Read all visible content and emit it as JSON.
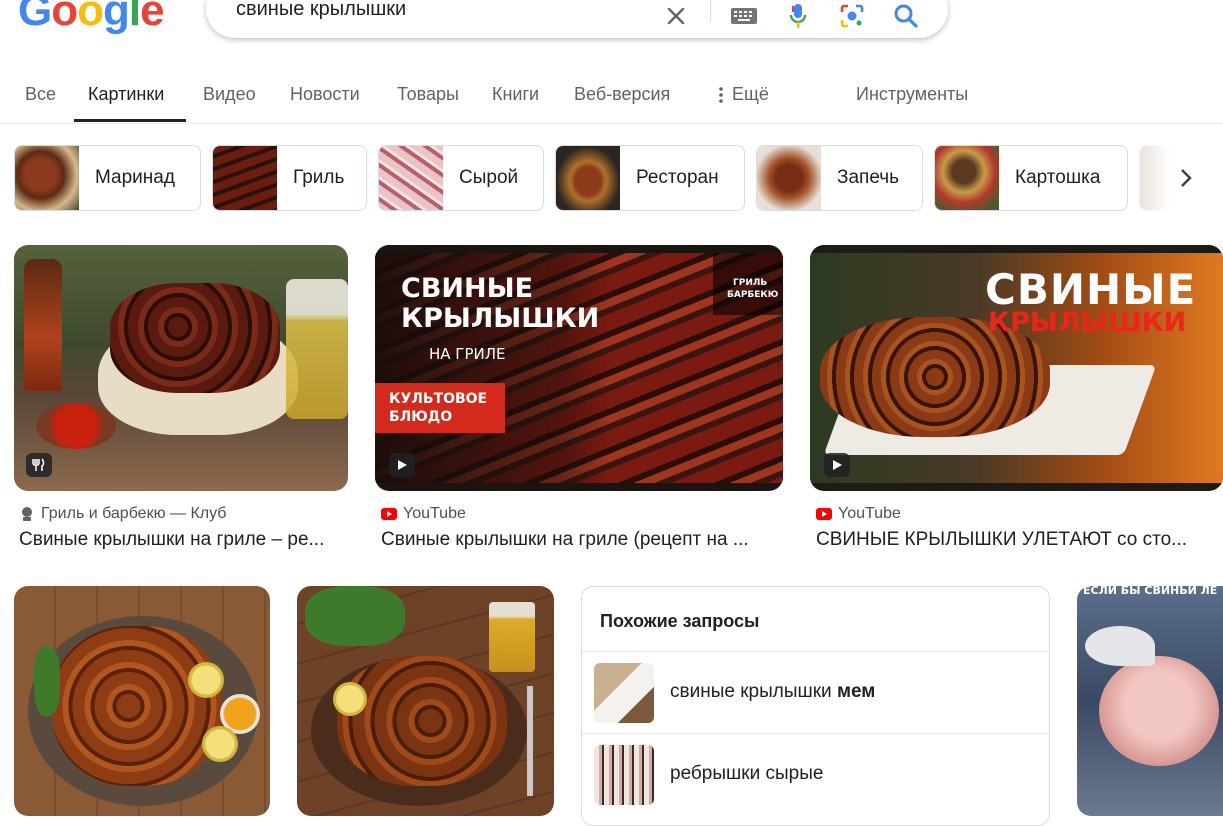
{
  "header": {
    "logo_letters": [
      "G",
      "o",
      "o",
      "g",
      "l",
      "e"
    ],
    "search_query": "свиные крылышки"
  },
  "tabs": [
    {
      "label": "Все"
    },
    {
      "label": "Картинки",
      "active": true
    },
    {
      "label": "Видео"
    },
    {
      "label": "Новости"
    },
    {
      "label": "Товары"
    },
    {
      "label": "Книги"
    },
    {
      "label": "Веб-версия"
    },
    {
      "label": "Ещё"
    },
    {
      "label": "Инструменты"
    }
  ],
  "chips": [
    {
      "label": "Маринад"
    },
    {
      "label": "Гриль"
    },
    {
      "label": "Сырой"
    },
    {
      "label": "Ресторан"
    },
    {
      "label": "Запечь"
    },
    {
      "label": "Картошка"
    }
  ],
  "results": [
    {
      "source": "Гриль и барбекю — Клуб",
      "caption": "Свиные крылышки на гриле – ре...",
      "badge": "recipe-icon"
    },
    {
      "source": "YouTube",
      "caption": "Свиные крылышки на гриле (рецепт на ...",
      "badge": "play-icon",
      "overlay": {
        "line1": "СВИНЫЕ",
        "line2": "КРЫЛЫШКИ",
        "line3": "НА ГРИЛЕ",
        "line4": "КУЛЬТОВОЕ",
        "line5": "БЛЮДО",
        "logo1": "ГРИЛЬ",
        "logo2": "БАРБЕКЮ"
      }
    },
    {
      "source": "YouTube",
      "caption": "СВИНЫЕ КРЫЛЫШКИ УЛЕТАЮТ со сто...",
      "badge": "play-icon",
      "overlay": {
        "line1": "СВИНЫЕ",
        "line2": "КРЫЛЫШКИ"
      }
    }
  ],
  "related": {
    "title": "Похожие запросы",
    "items": [
      {
        "text": "свиные крылышки ",
        "bold": "мем"
      },
      {
        "text": "ребрышки сырые",
        "bold": ""
      }
    ]
  },
  "meme_text": "ЕСЛИ БЫ СВИНЬИ ЛЕ",
  "colors": {
    "accent": "#1a73e8",
    "youtube": "#ff0000",
    "active_tab": "#202124"
  }
}
